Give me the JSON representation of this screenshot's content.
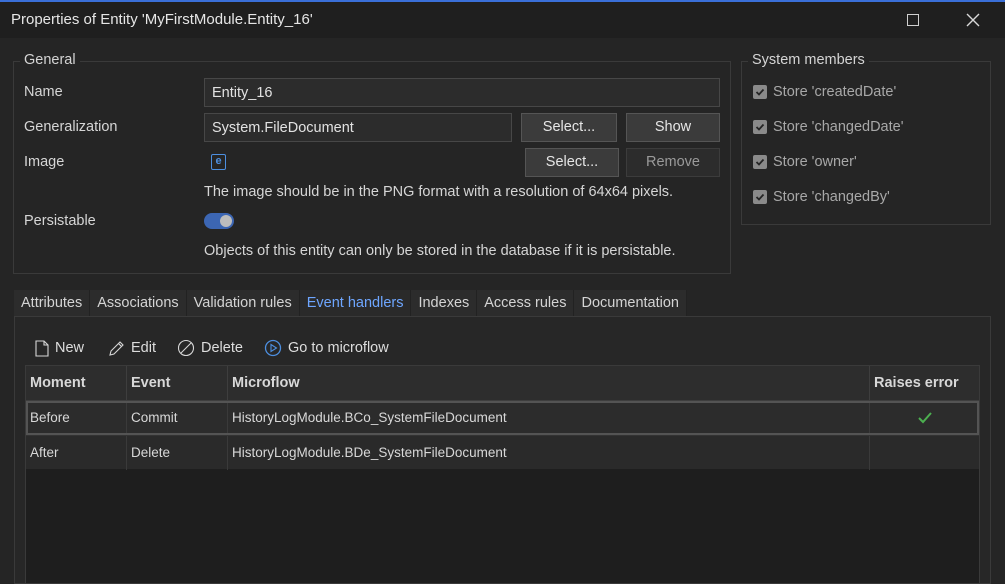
{
  "window": {
    "title": "Properties of Entity 'MyFirstModule.Entity_16'"
  },
  "general": {
    "legend": "General",
    "name_label": "Name",
    "name_value": "Entity_16",
    "generalization_label": "Generalization",
    "generalization_value": "System.FileDocument",
    "generalization_select": "Select...",
    "generalization_show": "Show",
    "image_label": "Image",
    "image_icon_glyph": "e",
    "image_select": "Select...",
    "image_remove": "Remove",
    "image_note": "The image should be in the PNG format with a resolution of 64x64 pixels.",
    "persistable_label": "Persistable",
    "persistable_on": true,
    "persistable_note": "Objects of this entity can only be stored in the database if it is persistable."
  },
  "system_members": {
    "legend": "System members",
    "items": [
      {
        "label": "Store 'createdDate'",
        "checked": true
      },
      {
        "label": "Store 'changedDate'",
        "checked": true
      },
      {
        "label": "Store 'owner'",
        "checked": true
      },
      {
        "label": "Store 'changedBy'",
        "checked": true
      }
    ]
  },
  "tabs": [
    {
      "label": "Attributes"
    },
    {
      "label": "Associations"
    },
    {
      "label": "Validation rules"
    },
    {
      "label": "Event handlers",
      "active": true
    },
    {
      "label": "Indexes"
    },
    {
      "label": "Access rules"
    },
    {
      "label": "Documentation"
    }
  ],
  "toolbar": {
    "new_label": "New",
    "edit_label": "Edit",
    "delete_label": "Delete",
    "goto_label": "Go to microflow"
  },
  "table": {
    "columns": [
      "Moment",
      "Event",
      "Microflow",
      "Raises error"
    ],
    "rows": [
      {
        "moment": "Before",
        "event": "Commit",
        "microflow": "HistoryLogModule.BCo_SystemFileDocument",
        "raises_error": true
      },
      {
        "moment": "After",
        "event": "Delete",
        "microflow": "HistoryLogModule.BDe_SystemFileDocument",
        "raises_error": false
      }
    ]
  },
  "colors": {
    "accent": "#6ea6ff",
    "check_green": "#4caf50"
  }
}
